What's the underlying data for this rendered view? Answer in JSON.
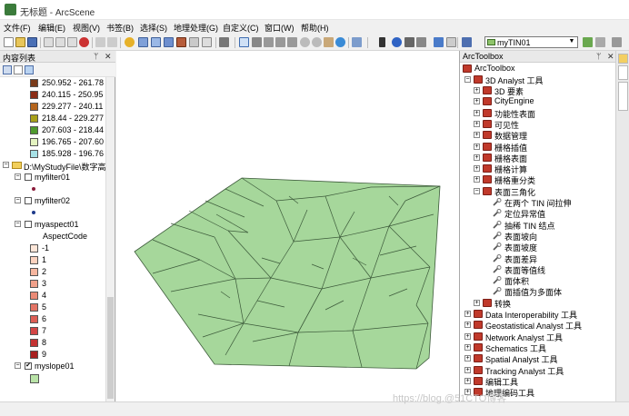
{
  "window": {
    "title": "无标题 - ArcScene"
  },
  "menu": [
    "文件(F)",
    "编辑(E)",
    "视图(V)",
    "书签(B)",
    "选择(S)",
    "地理处理(G)",
    "自定义(C)",
    "窗口(W)",
    "帮助(H)"
  ],
  "toolbar": {
    "layer_selected": "myTIN01"
  },
  "toc": {
    "title": "内容列表",
    "slope_classes": [
      {
        "label": "250.952 - 261.78",
        "color": "#7a3b1a"
      },
      {
        "label": "240.115 - 250.95",
        "color": "#8b2c16"
      },
      {
        "label": "229.277 - 240.11",
        "color": "#b5651d"
      },
      {
        "label": "218.44 - 229.277",
        "color": "#a7a01a"
      },
      {
        "label": "207.603 - 218.44",
        "color": "#4f9a2e"
      },
      {
        "label": "196.765 - 207.60",
        "color": "#e4f3c0"
      },
      {
        "label": "185.928 - 196.76",
        "color": "#a7e1e6"
      }
    ],
    "group_label": "D:\\MyStudyFile\\数字高",
    "layers": {
      "filter1": "myfilter01",
      "filter2": "myfilter02",
      "aspect": "myaspect01",
      "aspect_field": "AspectCode",
      "slope": "myslope01"
    },
    "aspect_classes": [
      {
        "label": "-1",
        "color": "#fde6d8"
      },
      {
        "label": "1",
        "color": "#fbd2bf"
      },
      {
        "label": "2",
        "color": "#f6b69f"
      },
      {
        "label": "3",
        "color": "#f0a08a"
      },
      {
        "label": "4",
        "color": "#ea8a76"
      },
      {
        "label": "5",
        "color": "#e37465"
      },
      {
        "label": "6",
        "color": "#dc5e55"
      },
      {
        "label": "7",
        "color": "#d24545"
      },
      {
        "label": "8",
        "color": "#c33232"
      },
      {
        "label": "9",
        "color": "#a81f1f"
      }
    ],
    "slope_swatch_color": "#b9e3a7"
  },
  "arctoolbox": {
    "title": "ArcToolbox",
    "root": "ArcToolbox",
    "analyst3d": "3D Analyst 工具",
    "analyst3d_children": [
      "3D 要素",
      "CityEngine",
      "功能性表面",
      "可见性",
      "数据管理",
      "栅格插值",
      "栅格表面",
      "栅格计算",
      "栅格重分类",
      "表面三角化"
    ],
    "tin_tools": [
      "在两个 TIN 间拉伸",
      "定位异常值",
      "抽稀 TIN 结点",
      "表面坡向",
      "表面坡度",
      "表面差异",
      "表面等值线",
      "面体积",
      "面插值为多面体"
    ],
    "convert": "转换",
    "toolboxes": [
      "Data Interoperability 工具",
      "Geostatistical Analyst 工具",
      "Network Analyst 工具",
      "Schematics 工具",
      "Spatial Analyst 工具",
      "Tracking Analyst 工具",
      "编辑工具",
      "地理编码工具"
    ]
  },
  "scene": {
    "surface_color": "#a6d79b",
    "line_color": "#3c5a3a"
  },
  "watermark": "https://blog.@51CTO博客"
}
